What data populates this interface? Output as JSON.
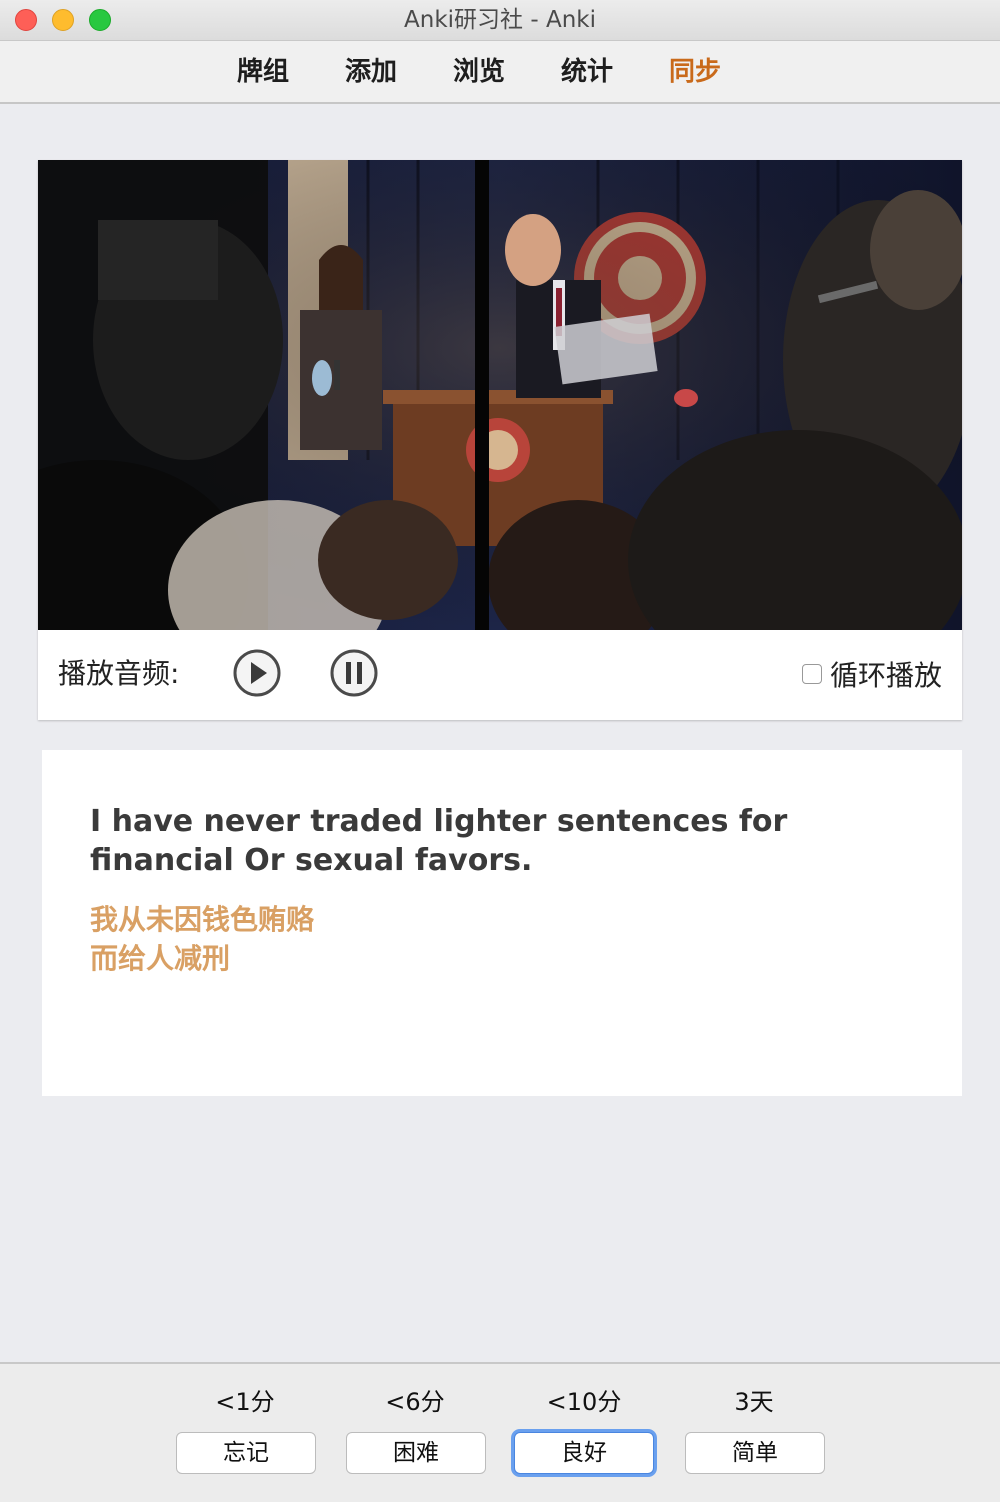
{
  "window": {
    "title": "Anki研习社 - Anki"
  },
  "toolbar": {
    "items": [
      {
        "label": "牌组"
      },
      {
        "label": "添加"
      },
      {
        "label": "浏览"
      },
      {
        "label": "统计"
      },
      {
        "label": "同步",
        "active": true
      }
    ],
    "active_color": "#c96a1b"
  },
  "card": {
    "audio_label": "播放音频:",
    "loop_label": "循环播放",
    "loop_checked": false,
    "english": "I have never traded lighter sentences for financial Or sexual favors.",
    "chinese_line1": "我从未因钱色贿赂",
    "chinese_line2": "而给人减刑",
    "chinese_color": "#d9a064"
  },
  "answer": {
    "buttons": [
      {
        "interval": "<1分",
        "label": "忘记"
      },
      {
        "interval": "<6分",
        "label": "困难"
      },
      {
        "interval": "<10分",
        "label": "良好",
        "focused": true
      },
      {
        "interval": "3天",
        "label": "简单"
      }
    ],
    "focus_color": "#6aa0ee"
  }
}
